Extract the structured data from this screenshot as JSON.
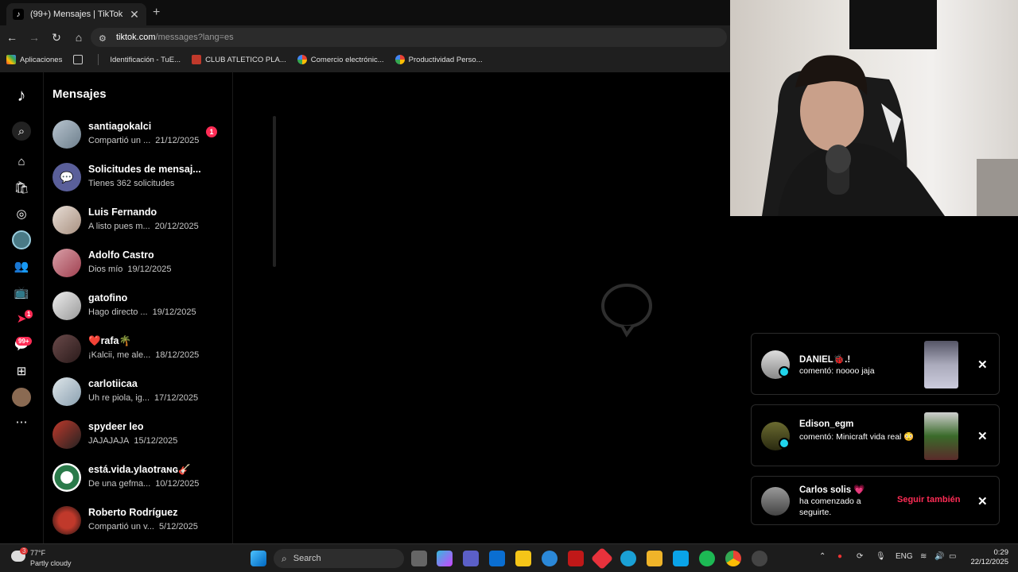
{
  "browser": {
    "tab_title": "(99+) Mensajes | TikTok",
    "url_host": "tiktok.com",
    "url_path": "/messages?lang=es",
    "bookmarks": [
      "Aplicaciones",
      "Identificación - TuE...",
      "CLUB ATLETICO PLA...",
      "Comercio electrónic...",
      "Productividad Perso..."
    ]
  },
  "sidebar": {
    "title": "Mensajes",
    "badges": {
      "notifications": "1",
      "inbox": "99+"
    }
  },
  "conversations": [
    {
      "name": "santiagokalci",
      "preview": "Compartió un ...",
      "date": "21/12/2025",
      "unread": "1"
    },
    {
      "name": "Solicitudes de mensaj...",
      "preview": "Tienes 362 solicitudes",
      "date": ""
    },
    {
      "name": "Luis Fernando",
      "preview": "A listo pues m...",
      "date": "20/12/2025"
    },
    {
      "name": "Adolfo Castro",
      "preview": "Dios mío",
      "date": "19/12/2025"
    },
    {
      "name": "gatofino",
      "preview": "Hago directo ...",
      "date": "19/12/2025"
    },
    {
      "name": "❤️rafa🌴",
      "preview": "¡Kalcii, me ale...",
      "date": "18/12/2025"
    },
    {
      "name": "carlotiicaa",
      "preview": "Uh re piola, ig...",
      "date": "17/12/2025"
    },
    {
      "name": "spydeer leo",
      "preview": "JAJAJAJA",
      "date": "15/12/2025"
    },
    {
      "name": "está.vida.ylaotraɴɢ🎸",
      "preview": "De una gefma...",
      "date": "10/12/2025"
    },
    {
      "name": "Roberto Rodríguez",
      "preview": "Compartió un v...",
      "date": "5/12/2025"
    }
  ],
  "notifications": [
    {
      "user": "DANIEL🐞.!",
      "text": "comentó: noooo jaja"
    },
    {
      "user": "Edison_egm",
      "text": "comentó: Minicraft vida real 😳"
    },
    {
      "user": "Carlos solis 💗",
      "text": "ha comenzado a seguirte.",
      "action": "Seguir también"
    }
  ],
  "taskbar": {
    "weather_temp": "77°F",
    "weather_desc": "Partly cloudy",
    "weather_badge": "3",
    "search_placeholder": "Search",
    "lang": "ENG",
    "time": "0:29",
    "date": "22/12/2025"
  }
}
